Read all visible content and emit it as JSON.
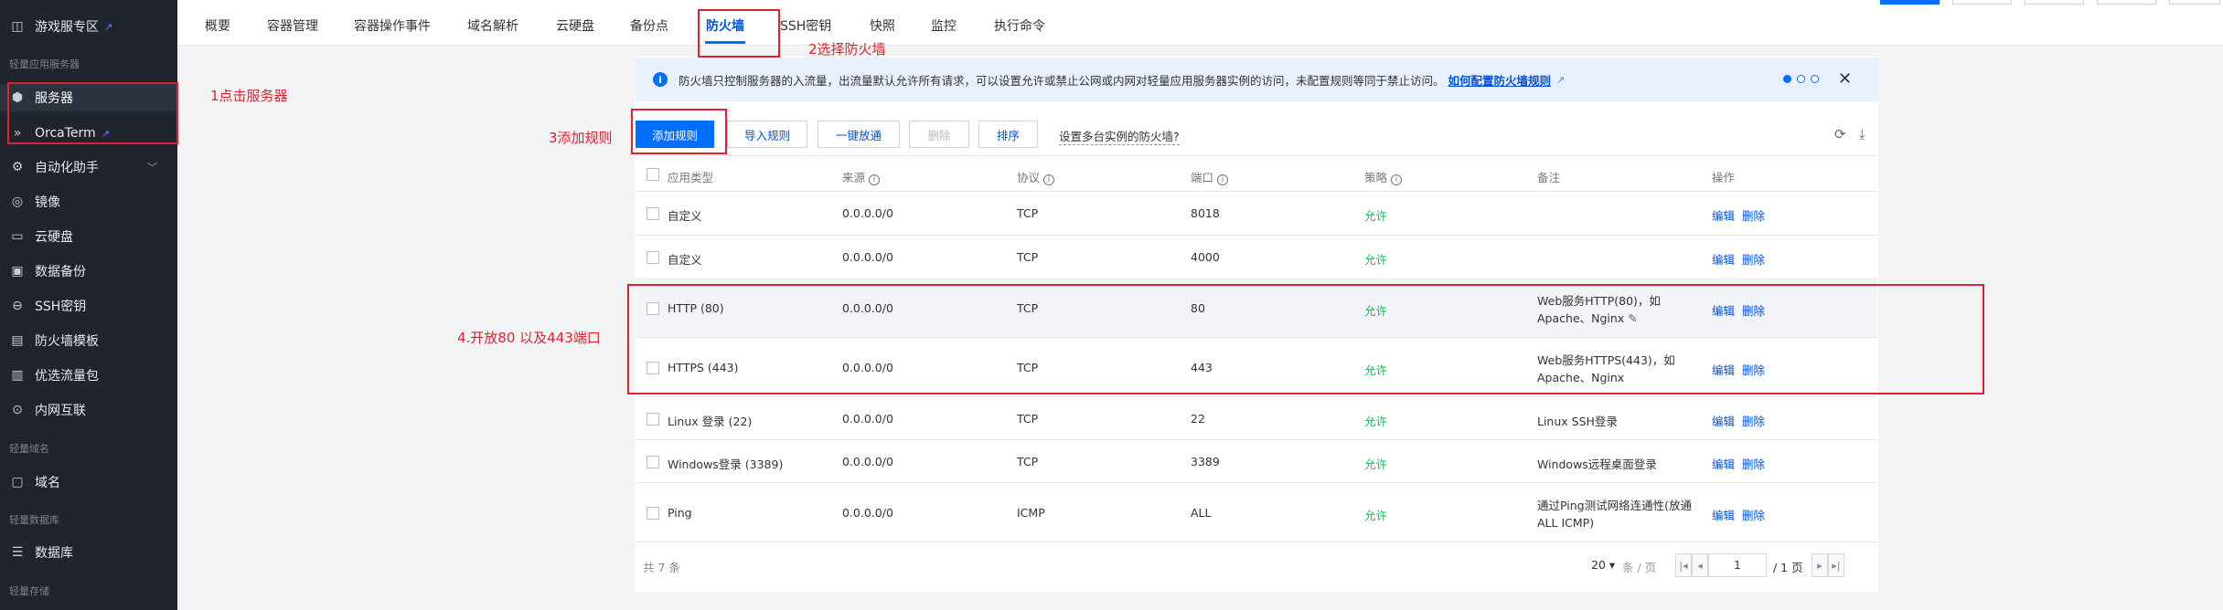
{
  "sidebar": {
    "items": [
      {
        "label": "游戏服专区",
        "icon": "game-server-icon"
      },
      {
        "label": "服务器",
        "icon": "server-icon"
      },
      {
        "label": "OrcaTerm",
        "icon": "terminal-icon"
      },
      {
        "label": "自动化助手",
        "icon": "automation-icon"
      },
      {
        "label": "镜像",
        "icon": "image-icon"
      },
      {
        "label": "云硬盘",
        "icon": "disk-icon"
      },
      {
        "label": "数据备份",
        "icon": "backup-icon"
      },
      {
        "label": "SSH密钥",
        "icon": "ssh-key-icon"
      },
      {
        "label": "防火墙模板",
        "icon": "firewall-template-icon"
      },
      {
        "label": "优选流量包",
        "icon": "traffic-package-icon"
      },
      {
        "label": "内网互联",
        "icon": "intranet-icon"
      },
      {
        "label": "域名",
        "icon": "domain-icon"
      },
      {
        "label": "数据库",
        "icon": "database-icon"
      }
    ],
    "groups": [
      "轻量应用服务器",
      "轻量域名",
      "轻量数据库",
      "轻量存储"
    ]
  },
  "tabs": [
    "概要",
    "容器管理",
    "容器操作事件",
    "域名解析",
    "云硬盘",
    "备份点",
    "防火墙",
    "SSH密钥",
    "快照",
    "监控",
    "执行命令"
  ],
  "active_tab": "防火墙",
  "notice": {
    "text": "防火墙只控制服务器的入流量，出流量默认允许所有请求，可以设置允许或禁止公网或内网对轻量应用服务器实例的访问，未配置规则等同于禁止访问。",
    "link": "如何配置防火墙规则",
    "close": "✕"
  },
  "toolbar": {
    "add": "添加规则",
    "import": "导入规则",
    "allow_all": "一键放通",
    "delete": "删除",
    "sort": "排序",
    "multi": "设置多台实例的防火墙?"
  },
  "table": {
    "headers": {
      "type": "应用类型",
      "source": "来源",
      "protocol": "协议",
      "port": "端口",
      "policy": "策略",
      "note": "备注",
      "ops": "操作"
    },
    "rows": [
      {
        "type": "自定义",
        "source": "0.0.0.0/0",
        "protocol": "TCP",
        "port": "8018",
        "policy": "允许",
        "note": "",
        "note2": ""
      },
      {
        "type": "自定义",
        "source": "0.0.0.0/0",
        "protocol": "TCP",
        "port": "4000",
        "policy": "允许",
        "note": "",
        "note2": ""
      },
      {
        "type": "HTTP (80)",
        "source": "0.0.0.0/0",
        "protocol": "TCP",
        "port": "80",
        "policy": "允许",
        "note": "Web服务HTTP(80)，如",
        "note2": "Apache、Nginx"
      },
      {
        "type": "HTTPS (443)",
        "source": "0.0.0.0/0",
        "protocol": "TCP",
        "port": "443",
        "policy": "允许",
        "note": "Web服务HTTPS(443)，如",
        "note2": "Apache、Nginx"
      },
      {
        "type": "Linux 登录 (22)",
        "source": "0.0.0.0/0",
        "protocol": "TCP",
        "port": "22",
        "policy": "允许",
        "note": "Linux SSH登录",
        "note2": ""
      },
      {
        "type": "Windows登录 (3389)",
        "source": "0.0.0.0/0",
        "protocol": "TCP",
        "port": "3389",
        "policy": "允许",
        "note": "Windows远程桌面登录",
        "note2": ""
      },
      {
        "type": "Ping",
        "source": "0.0.0.0/0",
        "protocol": "ICMP",
        "port": "ALL",
        "policy": "允许",
        "note": "通过Ping测试网络连通性(放通",
        "note2": "ALL ICMP)"
      }
    ],
    "op_edit": "编辑",
    "op_delete": "删除"
  },
  "pager": {
    "total": "共 7 条",
    "page_size": "20",
    "per_page": "条 / 页",
    "page": "1",
    "pages": "/ 1 页"
  },
  "annotations": {
    "a1": "1点击服务器",
    "a2": "2选择防火墙",
    "a3": "3添加规则",
    "a4": "4.开放80 以及443端口"
  }
}
